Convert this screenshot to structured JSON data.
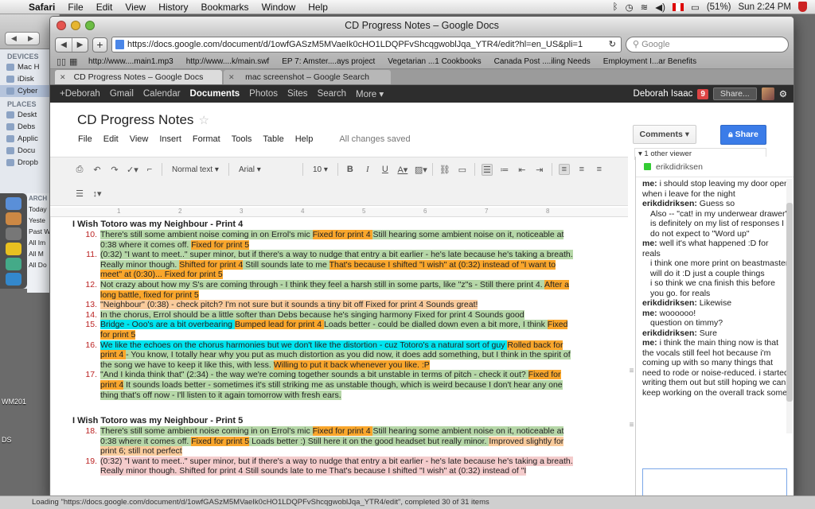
{
  "menubar": {
    "app": "Safari",
    "items": [
      "File",
      "Edit",
      "View",
      "History",
      "Bookmarks",
      "Window",
      "Help"
    ],
    "battery": "(51%)",
    "clock": "Sun 2:24 PM"
  },
  "finder": {
    "devices_label": "DEVICES",
    "devices": [
      "Mac H",
      "iDisk",
      "Cyber"
    ],
    "places_label": "PLACES",
    "places": [
      "Deskt",
      "Debs",
      "Applic",
      "Docu",
      "Dropb"
    ],
    "search_label": "ARCH",
    "search_items": [
      "Today",
      "Yeste",
      "Past W",
      "All Im",
      "All M",
      "All Do"
    ]
  },
  "desktop": {
    "label1": "WM201",
    "label2": "DS"
  },
  "browser": {
    "title": "CD Progress Notes – Google Docs",
    "url": "https://docs.google.com/document/d/1owfGASzM5MVaeIk0cHO1LDQPFvShcqgwoblJqa_YTR4/edit?hl=en_US&pli=1",
    "search_placeholder": "Google",
    "bookmarks": [
      "http://www....main1.mp3",
      "http://www....k/main.swf",
      "EP 7: Amster....ays project",
      "Vegetarian ...1 Cookbooks",
      "Canada Post ....iling Needs",
      "Employment I...ar Benefits"
    ],
    "tabs": [
      {
        "label": "CD Progress Notes – Google Docs",
        "active": true
      },
      {
        "label": "mac screenshot – Google Search",
        "active": false
      }
    ]
  },
  "gbar": {
    "links": [
      "+Deborah",
      "Gmail",
      "Calendar",
      "Documents",
      "Photos",
      "Sites",
      "Search",
      "More ▾"
    ],
    "active": "Documents",
    "user": "Deborah Isaac",
    "notifications": "9",
    "share": "Share..."
  },
  "doc": {
    "title": "CD Progress Notes",
    "menu": [
      "File",
      "Edit",
      "View",
      "Insert",
      "Format",
      "Tools",
      "Table",
      "Help"
    ],
    "saved": "All changes saved",
    "comments": "Comments",
    "share": "Share",
    "viewers": "1 other viewer",
    "toolbar": {
      "style": "Normal text",
      "font": "Arial",
      "size": "10"
    },
    "ruler": [
      "1",
      "2",
      "3",
      "4",
      "5",
      "6",
      "7",
      "8"
    ],
    "sections": [
      {
        "title": "I Wish Totoro was my Neighbour - Print 4",
        "entries": [
          {
            "num": "10.",
            "segs": [
              {
                "t": "There's still some ambient noise coming in on Errol's mic ",
                "c": "green"
              },
              {
                "t": "Fixed for print 4 ",
                "c": "orange"
              },
              {
                "t": " Still hearing some ambient noise on it, noticeable at 0:38 where it comes off. ",
                "c": "green"
              },
              {
                "t": "Fixed for print 5",
                "c": "orange"
              }
            ]
          },
          {
            "num": "11.",
            "segs": [
              {
                "t": "(0:32) \"I want to meet..\" super minor, but if there's a way to nudge that entry a bit earlier - he's late because he's taking a breath.  Really minor though. ",
                "c": "green"
              },
              {
                "t": "Shifted for print 4",
                "c": "orange"
              },
              {
                "t": " Still sounds late to me ",
                "c": "green"
              },
              {
                "t": "That's because I shifted \"I wish\" at (0:32) instead of \"I want to meet\" at (0:30)... Fixed for print 5",
                "c": "orange"
              }
            ]
          },
          {
            "num": "12.",
            "segs": [
              {
                "t": "Not crazy about how my S's are coming through - I think they feel a harsh still in some parts, like \"z\"s - Still there print 4. ",
                "c": "green"
              },
              {
                "t": "After a long battle, fixed for print 5",
                "c": "orange"
              }
            ]
          },
          {
            "num": "13.",
            "segs": [
              {
                "t": " \"Neighbour\" (0:38) - check pitch? I'm not sure but it sounds a tiny bit off Fixed for print 4 Sounds great!",
                "c": "peach"
              }
            ]
          },
          {
            "num": "14.",
            "segs": [
              {
                "t": "In the chorus, Errol should be a little softer than Debs because he's singing harmony Fixed for print 4 Sounds good",
                "c": "green"
              }
            ]
          },
          {
            "num": "15.",
            "segs": [
              {
                "t": "Bridge - Ooo's are a bit overbearing ",
                "c": "cyan"
              },
              {
                "t": "Bumped lead for print 4 ",
                "c": "orange"
              },
              {
                "t": "Loads better - could be dialled down even a bit more, I think ",
                "c": "green"
              },
              {
                "t": "Fixed for print 5",
                "c": "orange"
              }
            ]
          },
          {
            "num": "16.",
            "segs": [
              {
                "t": "We like the echoes on the chorus harmonies but we don't like the distortion - cuz Totoro's a natural sort of guy ",
                "c": "cyan"
              },
              {
                "t": "Rolled back for print 4 ",
                "c": "orange"
              },
              {
                "t": "- You know, I totally hear why you put as much distortion as you did now, it does add something, but I think in the spirit of the song we have to keep it like this, with less. ",
                "c": "green"
              },
              {
                "t": "Willing to put it back whenever you like. :P",
                "c": "orange"
              }
            ]
          },
          {
            "num": "17.",
            "segs": [
              {
                "t": "\"And I kinda think that\" (2:34) - the way we're coming together sounds a bit unstable in terms of pitch - check it out? ",
                "c": "green"
              },
              {
                "t": "Fixed for print 4",
                "c": "orange"
              },
              {
                "t": " It sounds loads better - sometimes it's still striking me as unstable though, which is weird because I don't hear any one thing that's off now - I'll listen to it again tomorrow with fresh ears.",
                "c": "green"
              }
            ]
          }
        ]
      },
      {
        "title": "I Wish Totoro was my Neighbour - Print 5",
        "entries": [
          {
            "num": "18.",
            "segs": [
              {
                "t": "There's still some ambient noise coming in on Errol's mic ",
                "c": "green"
              },
              {
                "t": "Fixed for print 4 ",
                "c": "orange"
              },
              {
                "t": " Still hearing some ambient noise on it, noticeable at 0:38 where it comes off. ",
                "c": "green"
              },
              {
                "t": "Fixed for print 5",
                "c": "orange"
              },
              {
                "t": " Loads better :) Still here it on the good headset but really minor. ",
                "c": "green"
              },
              {
                "t": "Improved slightly for print 6; still not perfect",
                "c": "peach"
              }
            ]
          },
          {
            "num": "19.",
            "segs": [
              {
                "t": "(0:32) \"I want to meet..\" super minor, but if there's a way to nudge that entry a bit earlier - he's late because he's taking a breath.  Really minor though. Shifted for print 4 Still sounds late to me That's because I shifted \"I wish\" at (0:32) instead of \"I",
                "c": "pink"
              }
            ]
          }
        ]
      }
    ]
  },
  "chat": {
    "user": "erikdidriksen",
    "messages": [
      {
        "who": "me:",
        "lines": [
          "i should stop leaving my door open when i leave for the night"
        ]
      },
      {
        "who": "erikdidriksen:",
        "lines": [
          "Guess so",
          "Also -- \"cat! in my underwear drawer\" is definitely on my list of responses I do not expect to \"Word up\""
        ]
      },
      {
        "who": "me:",
        "lines": [
          "well it's what happened :D for reals",
          "i think one more print on beastmaster will do it :D just a couple things",
          "i so think we cna finish this before you go. for reals"
        ]
      },
      {
        "who": "erikdidriksen:",
        "lines": [
          "Likewise"
        ]
      },
      {
        "who": "me:",
        "lines": [
          "woooooo!",
          "question on timmy?"
        ]
      },
      {
        "who": "erikdidriksen:",
        "lines": [
          "Sure"
        ]
      },
      {
        "who": "me:",
        "lines": [
          "i think the main thing now is that the vocals still feel hot because i'm coming up with so many things that need to rode or noise-reduced. i started writing them out but still hoping we can keep working on the overall track some"
        ]
      }
    ]
  },
  "status": "Loading \"https://docs.google.com/document/d/1owfGASzM5MVaeIk0cHO1LDQPFvShcqgwoblJqa_YTR4/edit\", completed 30 of 31 items"
}
